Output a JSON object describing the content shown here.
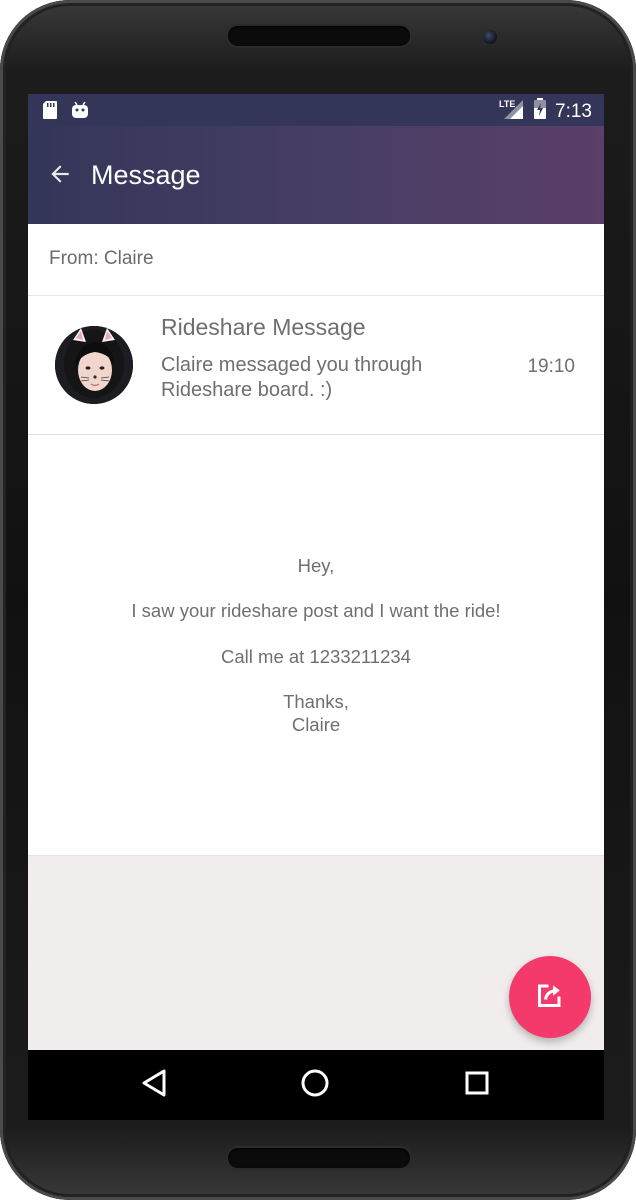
{
  "status_bar": {
    "time": "7:13",
    "network": "LTE",
    "icons": [
      "sd-card-icon",
      "android-icon",
      "lte-signal-icon",
      "battery-charging-icon"
    ]
  },
  "app_bar": {
    "title": "Message",
    "back_icon": "arrow-left-icon"
  },
  "from_row": {
    "text": "From: Claire"
  },
  "message": {
    "title": "Rideshare Message",
    "subtitle": "Claire messaged you through Rideshare board. :)",
    "time": "19:10",
    "avatar": "avatar-claire"
  },
  "body": {
    "greeting": "Hey,",
    "line1": "I saw your rideshare post and I want the ride!",
    "line2": "Call me at 1233211234",
    "signoff": "Thanks,",
    "signature": "Claire"
  },
  "fab": {
    "icon": "share-icon",
    "color": "#f4396b"
  },
  "nav_bar": {
    "icons": [
      "back-triangle-icon",
      "home-circle-icon",
      "recents-square-icon"
    ]
  },
  "colors": {
    "app_bar_start": "#333658",
    "app_bar_end": "#5a3f68",
    "text_gray": "#6f6f6f",
    "background": "#f1eded"
  }
}
